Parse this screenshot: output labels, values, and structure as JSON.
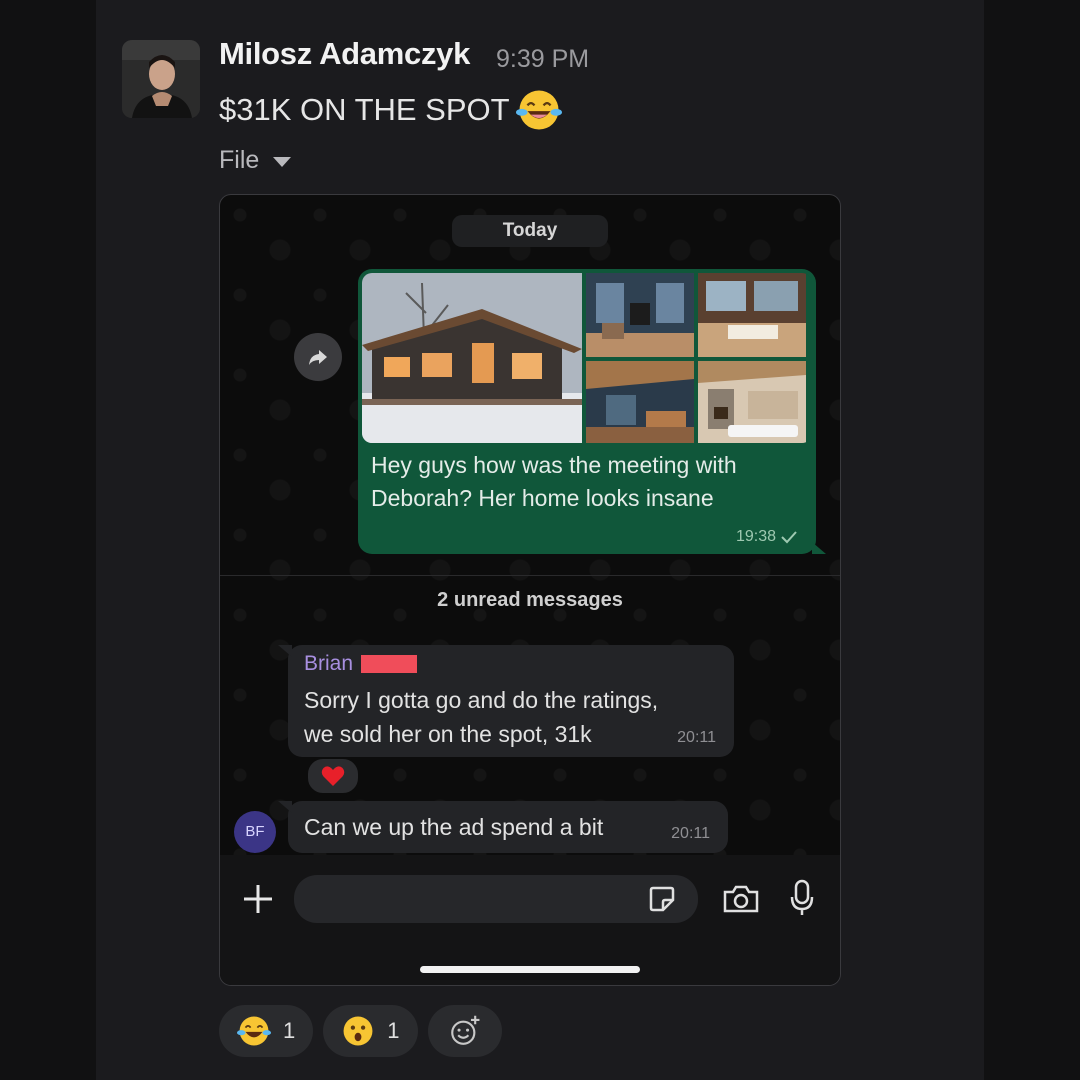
{
  "message": {
    "sender": "Milosz Adamczyk",
    "time": "9:39 PM",
    "text": "$31K ON THE SPOT",
    "text_emoji": "face-with-tears-of-joy-icon",
    "file_label": "File"
  },
  "screenshot": {
    "date_pill": "Today",
    "outgoing": {
      "text": "Hey guys how was the meeting with Deborah? Her home looks insane",
      "time": "19:38"
    },
    "unread_label": "2 unread messages",
    "incoming": [
      {
        "name": "Brian",
        "text": "Sorry I gotta go and do the ratings, we sold her on the spot, 31k",
        "time": "20:11",
        "reaction": "heart-icon"
      },
      {
        "avatar_initials": "BF",
        "text": "Can we up the ad spend a bit",
        "time": "20:11"
      }
    ]
  },
  "reactions": [
    {
      "emoji": "face-with-tears-of-joy-icon",
      "count": "1"
    },
    {
      "emoji": "astonished-face-icon",
      "count": "1"
    }
  ],
  "colors": {
    "background": "#1b1b1e",
    "outgoing_bubble": "#10573a",
    "incoming_bubble": "#232427",
    "sender_name_purple": "#a88fe0",
    "redaction": "#f04d5a"
  }
}
